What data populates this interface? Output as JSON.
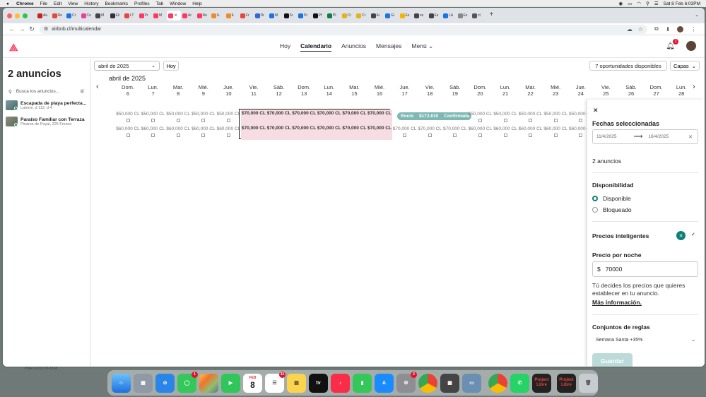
{
  "menubar": {
    "app": "Chrome",
    "items": [
      "File",
      "Edit",
      "View",
      "History",
      "Bookmarks",
      "Profiles",
      "Tab",
      "Window",
      "Help"
    ],
    "clock": "Sat 8 Feb 6:03PM"
  },
  "browser": {
    "tabs": [
      "Au",
      "Re",
      "Cr",
      "Cu",
      "M",
      "Eli",
      "LT",
      "Pr",
      "M",
      "",
      "Ar",
      "Re",
      "IL",
      "IL",
      "Fr",
      "Dr",
      "M",
      "Sr",
      "Pr",
      "Pf",
      "Pl",
      "Cr",
      "Cr",
      "Ai",
      "Gi",
      "Es",
      "es",
      "Es",
      "LA",
      "Ex",
      "ct"
    ],
    "favicon_colors": [
      "#c5221f",
      "#e8453c",
      "#1a73e8",
      "#e84393",
      "#444",
      "#333",
      "#e8453c",
      "#ff385c",
      "#ff385c",
      "#ff385c",
      "#ff385c",
      "#ff385c",
      "#f28b25",
      "#f28b25",
      "#e8453c",
      "#3367d6",
      "#1a73e8",
      "#111",
      "#1a73e8",
      "#111",
      "#0b8043",
      "#e2b31a",
      "#e2b31a",
      "#444",
      "#1a73e8",
      "#f4b400",
      "#444",
      "#444",
      "#1a73e8",
      "#888",
      "#555"
    ],
    "url": "airbnb.cl/multicalendar"
  },
  "header": {
    "nav": [
      "Hoy",
      "Calendario",
      "Anuncios",
      "Mensajes",
      "Menú"
    ],
    "notifications": "2"
  },
  "sidebar": {
    "title": "2 anuncios",
    "search_placeholder": "Busca los anuncios...",
    "listings": [
      {
        "title": "Escapada de playa perfecta...",
        "sub": "Latorre, d 113, d 4"
      },
      {
        "title": "Paraíso Familiar con Terraza",
        "sub": "Pinares de Puyai, 226 Fresno"
      }
    ]
  },
  "calendar": {
    "month_select": "abril de 2025",
    "today_btn": "Hoy",
    "opportunities": "7 oportunidades disponibles",
    "layers": "Capas",
    "month_label": "abril de 2025",
    "days": [
      {
        "dow": "Dom.",
        "num": "6"
      },
      {
        "dow": "Lun.",
        "num": "7"
      },
      {
        "dow": "Mar.",
        "num": "8"
      },
      {
        "dow": "Mié.",
        "num": "9"
      },
      {
        "dow": "Jue.",
        "num": "10"
      },
      {
        "dow": "Vie.",
        "num": "11"
      },
      {
        "dow": "Sáb.",
        "num": "12"
      },
      {
        "dow": "Dom.",
        "num": "13"
      },
      {
        "dow": "Lun.",
        "num": "14"
      },
      {
        "dow": "Mar.",
        "num": "15"
      },
      {
        "dow": "Mié.",
        "num": "16"
      },
      {
        "dow": "Jue.",
        "num": "17"
      },
      {
        "dow": "Vie.",
        "num": "18"
      },
      {
        "dow": "Sáb.",
        "num": "19"
      },
      {
        "dow": "Dom.",
        "num": "20"
      },
      {
        "dow": "Lun.",
        "num": "21"
      },
      {
        "dow": "Mar.",
        "num": "22"
      },
      {
        "dow": "Mié.",
        "num": "23"
      },
      {
        "dow": "Jue.",
        "num": "24"
      },
      {
        "dow": "Vie.",
        "num": "25"
      },
      {
        "dow": "Sáb.",
        "num": "26"
      },
      {
        "dow": "Dom.",
        "num": "27"
      },
      {
        "dow": "Lun.",
        "num": "28"
      }
    ],
    "row1": [
      "$50,000 CL",
      "$50,000 CL",
      "$50,000 CL",
      "$50,000 CL",
      "$50,000 CL",
      "$70,000 CL",
      "$70,000 CL",
      "$70,000 CL",
      "$70,000 CL",
      "$70,000 CL",
      "$70,000 CL",
      "",
      "",
      "",
      "$50,000 CL",
      "$50,000 CL",
      "$50,000 CL",
      "$50,000 CL",
      "$50,000 CL",
      "",
      "",
      "",
      ""
    ],
    "row2": [
      "$60,000 CL",
      "$60,000 CL",
      "$60,000 CL",
      "$60,000 CL",
      "$60,000 CL",
      "$70,000 CL",
      "$70,000 CL",
      "$70,000 CL",
      "$70,000 CL",
      "$70,000 CL",
      "$70,000 CL",
      "$70,000 CL",
      "$70,000 CL",
      "$70,000 CL",
      "$60,000 CL",
      "$60,000 CL",
      "$60,000 CL",
      "$60,000 CL",
      "$60,000 CL",
      "",
      "",
      "",
      ""
    ],
    "reservation": {
      "guest": "Rocío",
      "amount": "$172,610",
      "status": "Confirmada"
    }
  },
  "panel": {
    "title": "Fechas seleccionadas",
    "start": "11/4/2025",
    "end": "16/4/2025",
    "listings_count": "2 anuncios",
    "availability": "Disponibilidad",
    "available": "Disponible",
    "blocked": "Bloqueado",
    "smart_pricing": "Precios inteligentes",
    "price_label": "Precio por noche",
    "currency": "$",
    "price": "70000",
    "help": "Tú decides los precios que quieres establecer en tu anuncio.",
    "more": "Más información.",
    "rules_label": "Conjuntos de reglas",
    "rule": "Semana Santa +35%",
    "save": "Guardar"
  },
  "dock": {
    "calendar_month": "FEB",
    "calendar_day": "8",
    "messages_badge": "1",
    "reminders_badge": "31",
    "settings_badge": "2",
    "project": "Project",
    "libre": "Libre"
  },
  "wallpaper_text": "PSA 9 2012 06-1518"
}
